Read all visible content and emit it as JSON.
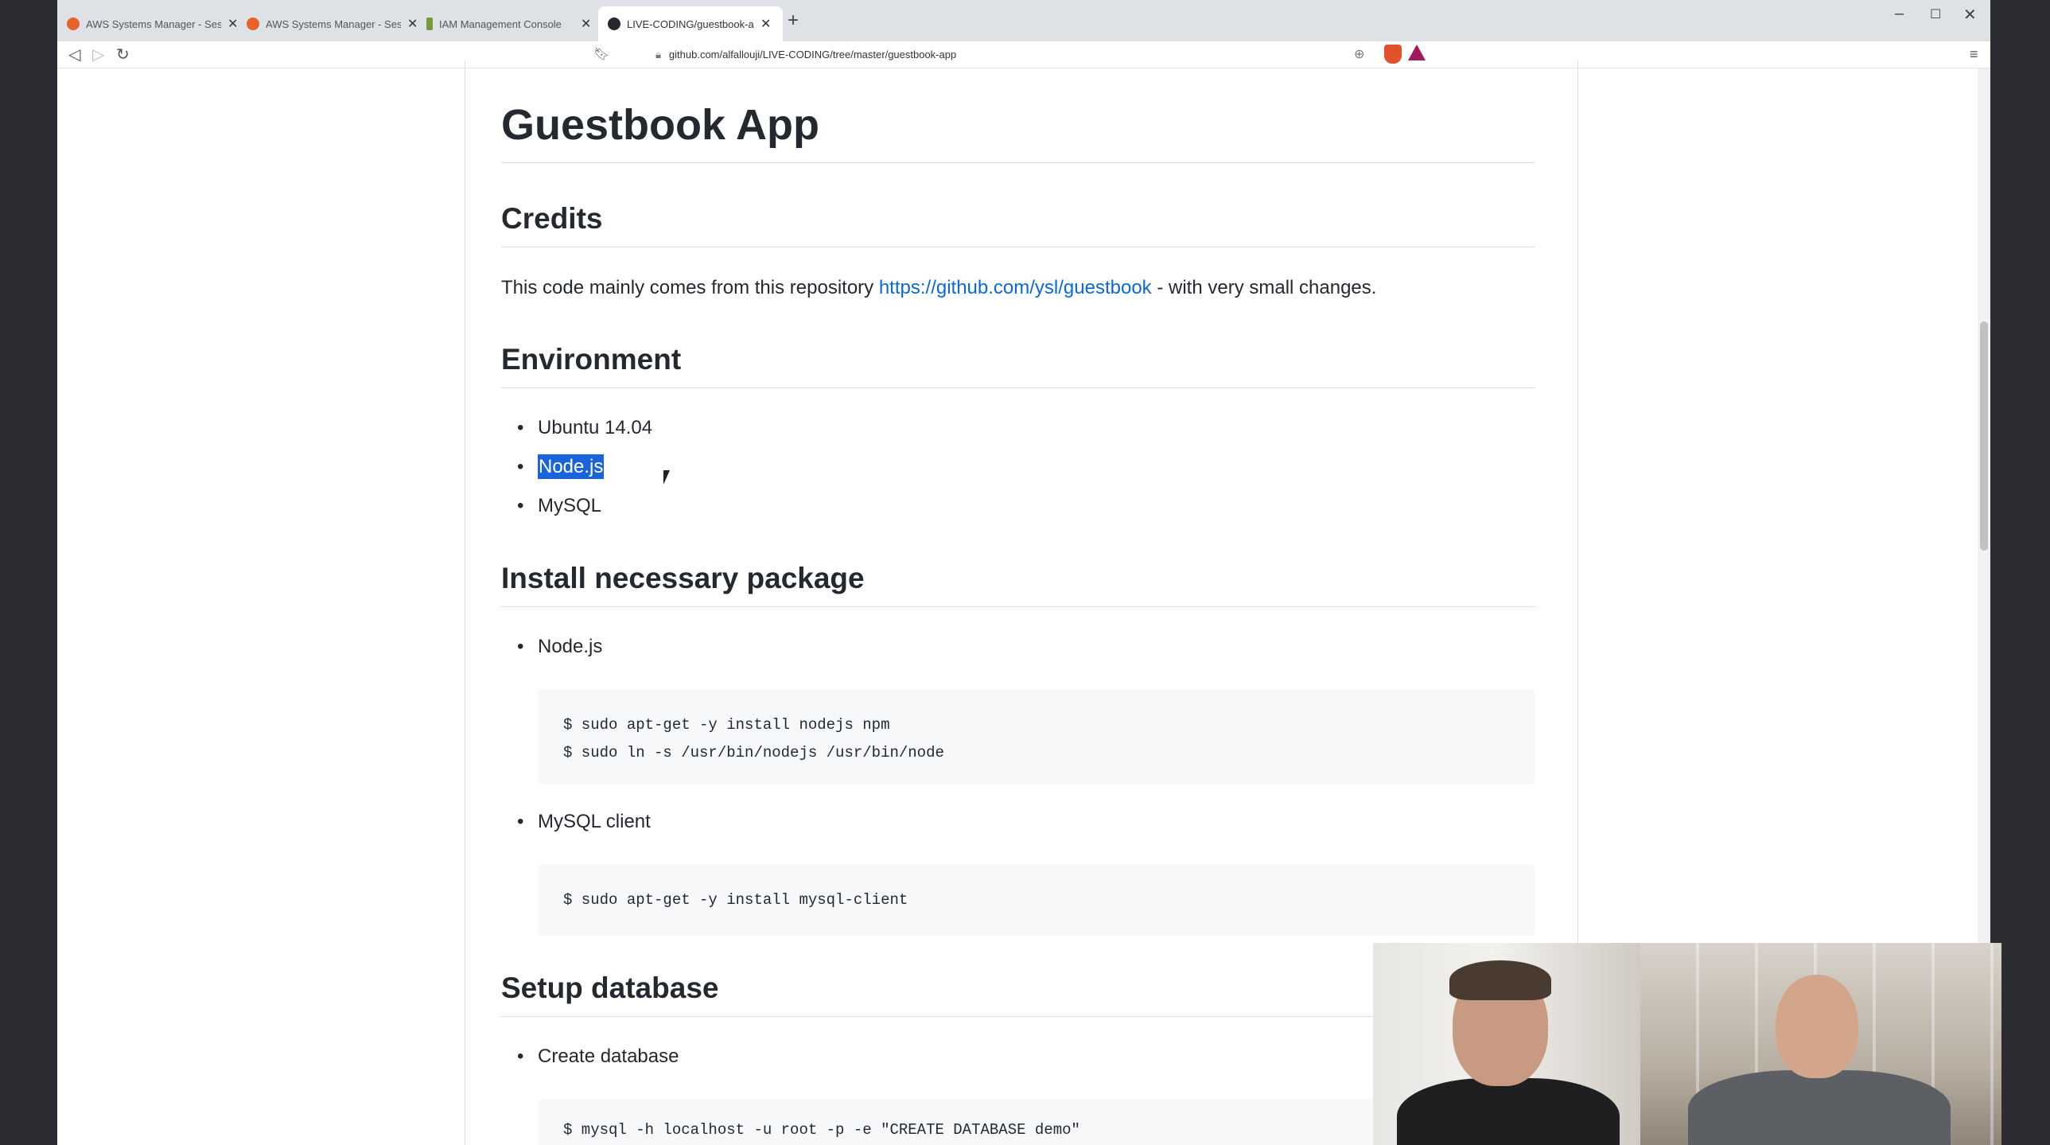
{
  "tabs": [
    {
      "title": "AWS Systems Manager - Session M",
      "color": "#e8632b",
      "active": false
    },
    {
      "title": "AWS Systems Manager - Session M",
      "color": "#e8632b",
      "active": false
    },
    {
      "title": "IAM Management Console",
      "color": "#7a9a3a",
      "active": false
    },
    {
      "title": "LIVE-CODING/guestbook-app at m",
      "color": "#24292f",
      "active": true
    }
  ],
  "address": {
    "url": "github.com/alfallouji/LIVE-CODING/tree/master/guestbook-app"
  },
  "readme": {
    "title": "Guestbook App",
    "credits": {
      "heading": "Credits",
      "text_before": "This code mainly comes from this repository ",
      "link": "https://github.com/ysl/guestbook",
      "text_after": " - with very small changes."
    },
    "environment": {
      "heading": "Environment",
      "items": [
        "Ubuntu 14.04",
        "Node.js",
        "MySQL"
      ]
    },
    "install": {
      "heading": "Install necessary package",
      "nodejs_label": "Node.js",
      "nodejs_code": "$ sudo apt-get -y install nodejs npm\n$ sudo ln -s /usr/bin/nodejs /usr/bin/node",
      "mysql_label": "MySQL client",
      "mysql_code": "$ sudo apt-get -y install mysql-client"
    },
    "database": {
      "heading": "Setup database",
      "create_label": "Create database",
      "create_code": "$ mysql -h localhost -u root -p -e \"CREATE DATABASE demo\""
    }
  }
}
